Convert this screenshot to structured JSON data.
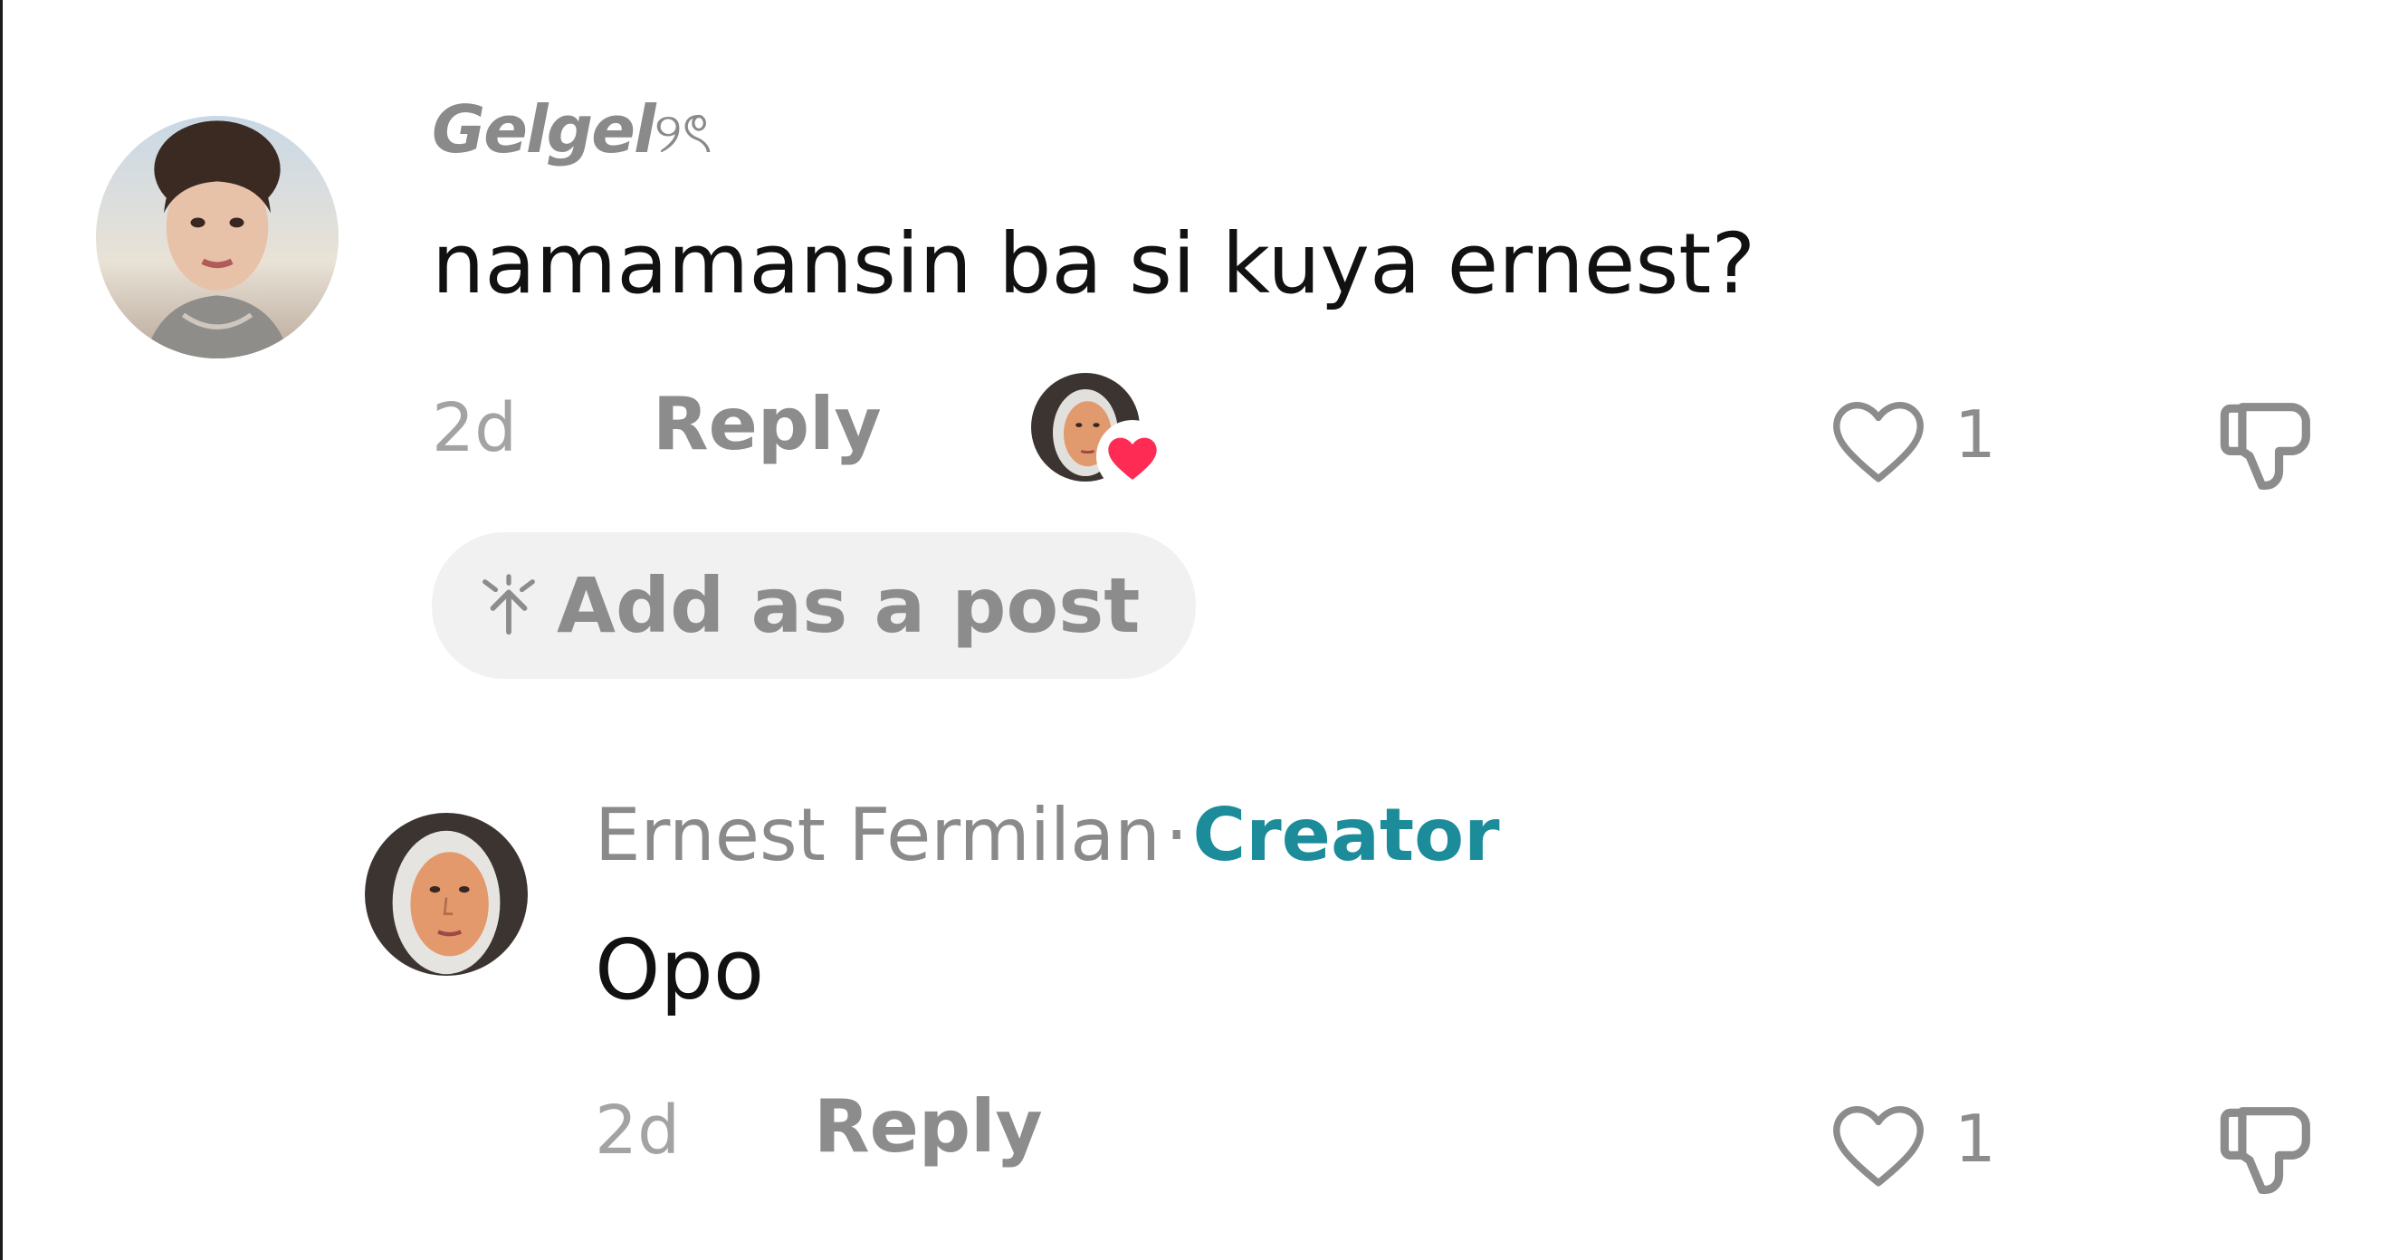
{
  "comment": {
    "username": "Gelgel",
    "username_symbols": "୨ৎ",
    "text": "namamansin ba si kuya ernest?",
    "time": "2d",
    "reply_label": "Reply",
    "like_count": "1",
    "add_post_label": "Add as a post",
    "like_icon": "heart-outline-icon",
    "dislike_icon": "thumbs-down-icon",
    "liked_by_creator_icon": "heart-filled-icon"
  },
  "reply": {
    "author": "Ernest Fermilan",
    "separator": "·",
    "badge": "Creator",
    "text": "Opo",
    "time": "2d",
    "reply_label": "Reply",
    "like_count": "1"
  },
  "colors": {
    "creator_badge": "#1c8c9a",
    "liked_heart": "#fe2c55",
    "muted_text": "#8a8a8a",
    "pill_bg": "#f1f1f1"
  }
}
